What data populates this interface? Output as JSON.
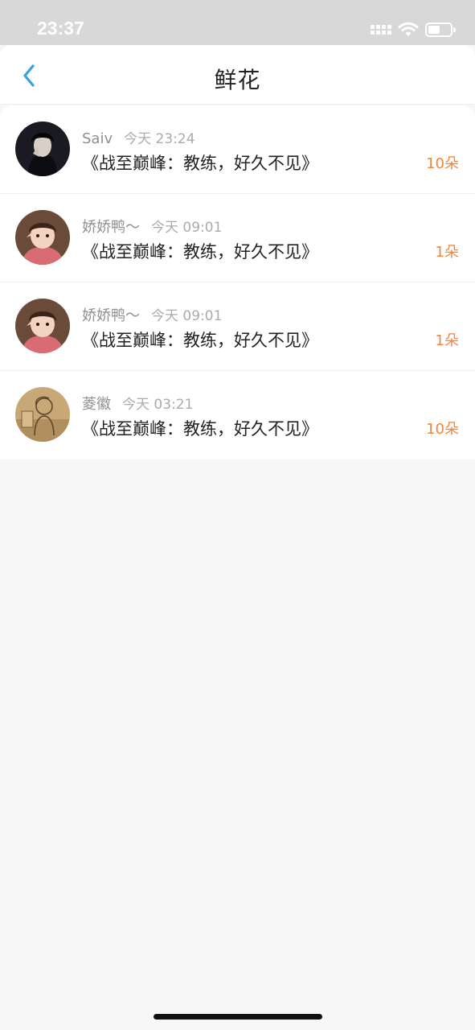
{
  "status_bar": {
    "time": "23:37"
  },
  "header": {
    "title": "鲜花",
    "back_icon": "chevron-left-icon"
  },
  "colors": {
    "accent": "#3aa0e0",
    "flower_count": "#f0873a"
  },
  "items": [
    {
      "user": "Saiv",
      "time": "今天 23:24",
      "work": "《战至巅峰：教练，好久不见》",
      "flowers": "10朵",
      "avatar": "dark-portrait"
    },
    {
      "user": "娇娇鸭～",
      "time": "今天 09:01",
      "work": "《战至巅峰：教练，好久不见》",
      "flowers": "1朵",
      "avatar": "child-pink"
    },
    {
      "user": "娇娇鸭～",
      "time": "今天 09:01",
      "work": "《战至巅峰：教练，好久不见》",
      "flowers": "1朵",
      "avatar": "child-pink"
    },
    {
      "user": "菱徽",
      "time": "今天 03:21",
      "work": "《战至巅峰：教练，好久不见》",
      "flowers": "10朵",
      "avatar": "sketch-gold"
    }
  ]
}
